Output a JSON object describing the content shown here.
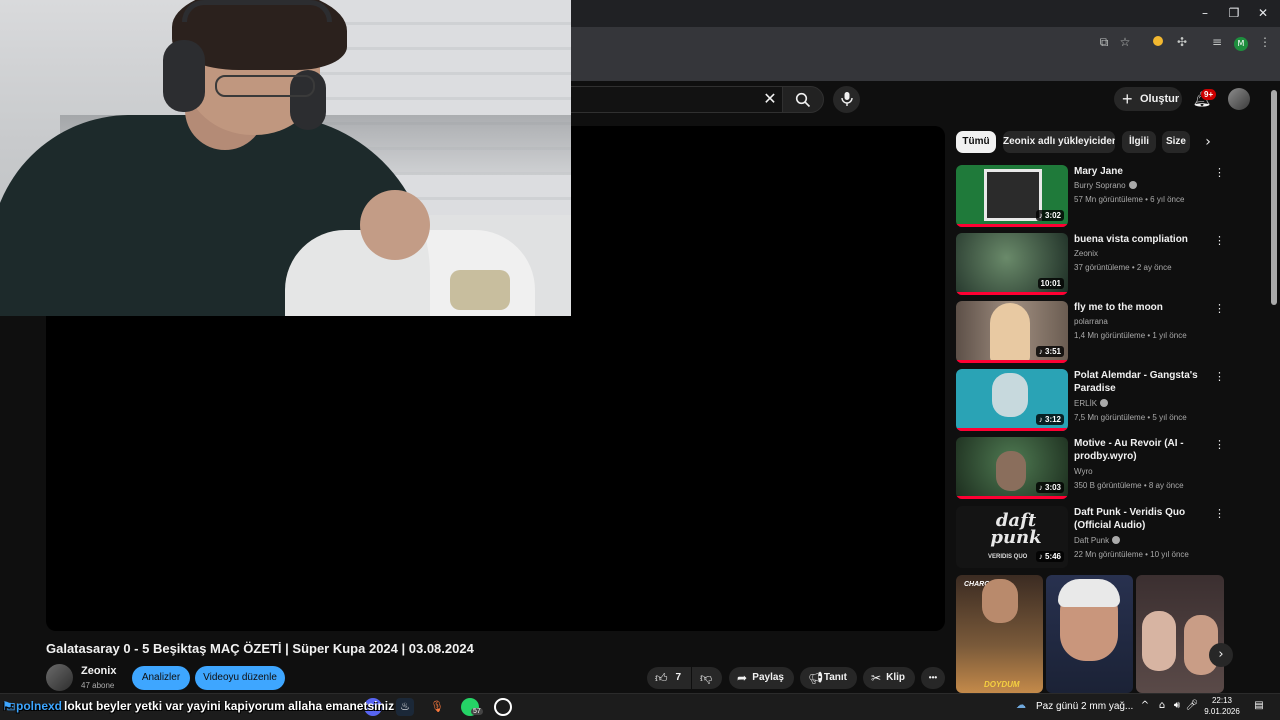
{
  "browser": {
    "window_controls": {
      "minimize": "–",
      "maximize": "❐",
      "close": "✕"
    },
    "profile_initial": "M"
  },
  "youtube": {
    "create_label": "Oluştur",
    "notification_count": "9+",
    "search_clear": "✕"
  },
  "video": {
    "title": "Galatasaray 0 - 5 Beşiktaş MAÇ ÖZETİ | Süper Kupa 2024 | 03.08.2024",
    "channel": "Zeonix",
    "subscribers": "47 abone",
    "analytics_label": "Analizler",
    "edit_label": "Videoyu düzenle",
    "like_count": "7",
    "share_label": "Paylaş",
    "promote_label": "Tanıt",
    "clip_label": "Klip",
    "more": "•••"
  },
  "chips": [
    {
      "label": "Tümü"
    },
    {
      "label": "Zeonix adlı yükleyiciden"
    },
    {
      "label": "İlgili"
    },
    {
      "label": "Size"
    }
  ],
  "recommendations": [
    {
      "title": "Mary Jane",
      "channel": "Burry Soprano",
      "verified": true,
      "meta": "57 Mn görüntüleme • 6 yıl önce",
      "duration": "♪ 3:02",
      "thumb_color": "#1f7a3a"
    },
    {
      "title": "buena vista compliation",
      "channel": "Zeonix",
      "verified": false,
      "meta": "37 görüntüleme • 2 ay önce",
      "duration": "10:01",
      "thumb_color": "#2e4a3c"
    },
    {
      "title": "fly me to the moon",
      "channel": "polarrana",
      "verified": false,
      "meta": "1,4 Mn görüntüleme • 1 yıl önce",
      "duration": "♪ 3:51",
      "thumb_color": "#8a7a6c"
    },
    {
      "title": "Polat Alemdar - Gangsta's Paradise",
      "channel": "ERLİK",
      "verified": true,
      "meta": "7,5 Mn görüntüleme • 5 yıl önce",
      "duration": "♪ 3:12",
      "thumb_color": "#2aa3b5"
    },
    {
      "title": "Motive - Au Revoir (AI - prodby.wyro)",
      "channel": "Wyro",
      "verified": false,
      "meta": "350 B görüntüleme • 8 ay önce",
      "duration": "♪ 3:03",
      "thumb_color": "#2f5a35"
    },
    {
      "title": "Daft Punk - Veridis Quo (Official Audio)",
      "channel": "Daft Punk",
      "verified": true,
      "meta": "22 Mn görüntüleme • 10 yıl önce",
      "duration": "♪ 5:46",
      "thumb_color": "#1a1a1a",
      "thumb_text": "daft punk",
      "thumb_sub": "VERIDIS QUO"
    }
  ],
  "shorts": [
    {
      "caption_top": "CHARONS?!",
      "caption_bottom": "DOYDUM",
      "color": "#5a4030"
    },
    {
      "caption_top": "",
      "caption_bottom": "",
      "color": "#2a3350"
    },
    {
      "caption_top": "",
      "caption_bottom": "",
      "color": "#4a3a3a"
    }
  ],
  "stream_overlay": {
    "username": "polnexd",
    "message": "lokut beyler yetki var yayini kapiyorum allaha emanetsiniz"
  },
  "taskbar": {
    "whatsapp_badge": "57",
    "weather": "Paz günü 2 mm yağ...",
    "time": "22:13",
    "date": "9.01.2026"
  }
}
